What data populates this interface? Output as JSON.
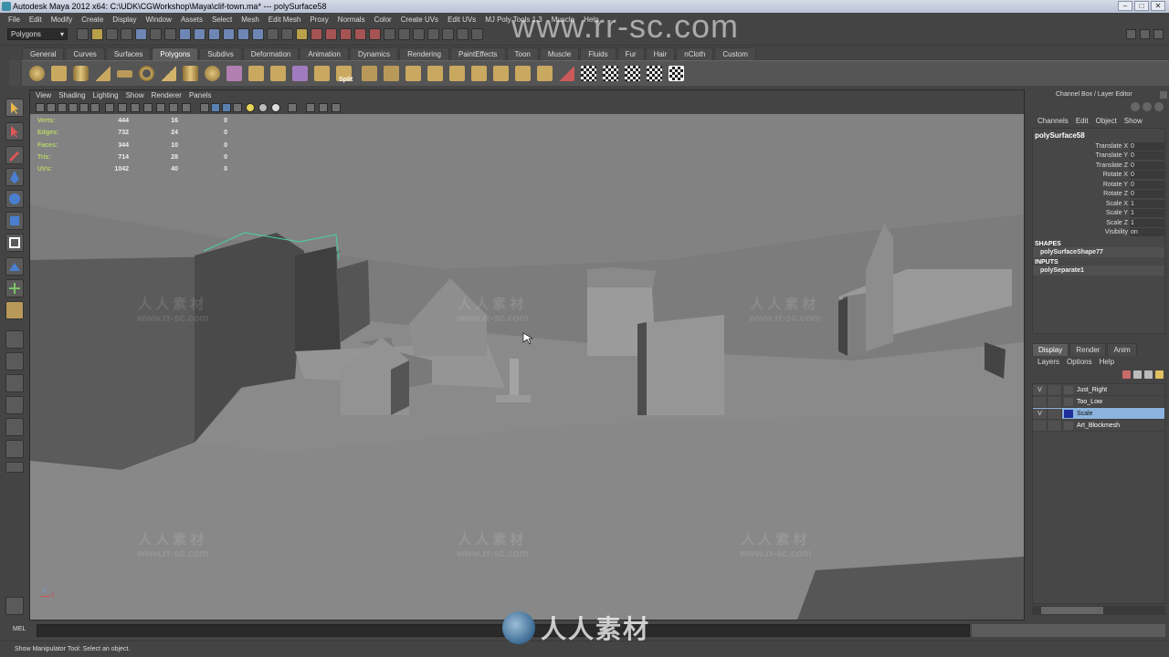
{
  "window": {
    "title": "Autodesk Maya 2012 x64: C:\\UDK\\CGWorkshop\\Maya\\clif-town.ma*   ---   polySurface58"
  },
  "menubar": [
    "File",
    "Edit",
    "Modify",
    "Create",
    "Display",
    "Window",
    "Assets",
    "Select",
    "Mesh",
    "Edit Mesh",
    "Proxy",
    "Normals",
    "Color",
    "Create UVs",
    "Edit UVs",
    "MJ Poly Tools 1.3",
    "Muscle",
    "Help"
  ],
  "status_line": {
    "mode": "Polygons"
  },
  "shelf": {
    "tabs": [
      "General",
      "Curves",
      "Surfaces",
      "Polygons",
      "Subdivs",
      "Deformation",
      "Animation",
      "Dynamics",
      "Rendering",
      "PaintEffects",
      "Toon",
      "Muscle",
      "Fluids",
      "Fur",
      "Hair",
      "nCloth",
      "Custom"
    ],
    "active_tab": "Polygons",
    "split_label": "Split"
  },
  "viewport": {
    "menu": [
      "View",
      "Shading",
      "Lighting",
      "Show",
      "Renderer",
      "Panels"
    ],
    "hud": [
      {
        "label": "Verts:",
        "v1": "444",
        "v2": "16",
        "v3": "0"
      },
      {
        "label": "Edges:",
        "v1": "732",
        "v2": "24",
        "v3": "0"
      },
      {
        "label": "Faces:",
        "v1": "344",
        "v2": "10",
        "v3": "0"
      },
      {
        "label": "Tris:",
        "v1": "714",
        "v2": "28",
        "v3": "0"
      },
      {
        "label": "UVs:",
        "v1": "1042",
        "v2": "40",
        "v3": "0"
      }
    ],
    "axis": {
      "y": "y",
      "x": "x"
    }
  },
  "channel_box": {
    "title": "Channel Box / Layer Editor",
    "menu": [
      "Channels",
      "Edit",
      "Object",
      "Show"
    ],
    "object": "polySurface58",
    "attributes": [
      {
        "name": "Translate X",
        "value": "0"
      },
      {
        "name": "Translate Y",
        "value": "0"
      },
      {
        "name": "Translate Z",
        "value": "0"
      },
      {
        "name": "Rotate X",
        "value": "0"
      },
      {
        "name": "Rotate Y",
        "value": "0"
      },
      {
        "name": "Rotate Z",
        "value": "0"
      },
      {
        "name": "Scale X",
        "value": "1"
      },
      {
        "name": "Scale Y",
        "value": "1"
      },
      {
        "name": "Scale Z",
        "value": "1"
      },
      {
        "name": "Visibility",
        "value": "on"
      }
    ],
    "shapes_header": "SHAPES",
    "shape": "polySurfaceShape77",
    "inputs_header": "INPUTS",
    "input": "polySeparate1"
  },
  "layer_editor": {
    "tabs": [
      "Display",
      "Render",
      "Anim"
    ],
    "active_tab": "Display",
    "menu": [
      "Layers",
      "Options",
      "Help"
    ],
    "layers": [
      {
        "vis": "V",
        "name": "Just_Right",
        "selected": false
      },
      {
        "vis": "",
        "name": "Too_Low",
        "selected": false
      },
      {
        "vis": "V",
        "name": "Scale",
        "selected": true
      },
      {
        "vis": "",
        "name": "Art_Blockmesh",
        "selected": false
      }
    ]
  },
  "command_line": {
    "label": "MEL"
  },
  "help_line": {
    "text": "Show Manipulator Tool: Select an object."
  },
  "watermark": {
    "url_big": "www.rr-sc.com",
    "cn": "人人素材",
    "url": "www.rr-sc.com",
    "bottom_text": "人人素材"
  },
  "colors": {
    "selection": "#8cb3dd",
    "layer_color_scale": "#20309a",
    "hud_label": "#b9d36a"
  }
}
